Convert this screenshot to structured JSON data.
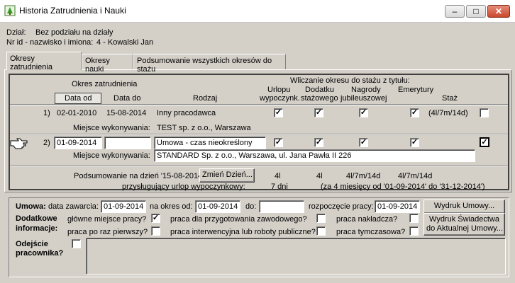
{
  "window": {
    "title": "Historia Zatrudnienia i Nauki",
    "minimize": "–",
    "maximize": "□",
    "close": "✕"
  },
  "info": {
    "dept_label": "Dział:",
    "dept_value": "Bez podziału na działy",
    "id_label": "Nr id - nazwisko i imiona:",
    "id_value": "4 - Kowalski Jan"
  },
  "tabs": [
    {
      "label": "Okresy zatrudnienia",
      "active": true
    },
    {
      "label": "Okresy nauki",
      "active": false
    },
    {
      "label": "Podsumowanie wszystkich okresów do stażu",
      "active": false
    }
  ],
  "table_header": {
    "group_employment": "Okres zatrudnienia",
    "date_from": "Data od",
    "date_to": "Data do",
    "type": "Rodzaj",
    "group_counting": "Wliczanie okresu do stażu z tytułu:",
    "col_leave_1": "Urlopu",
    "col_leave_2": "wypoczynk.",
    "col_bonus_1": "Dodatku",
    "col_bonus_2": "stażowego",
    "col_award_1": "Nagrody",
    "col_award_2": "jubileuszowej",
    "col_pension": "Emerytury",
    "col_seniority": "Staż"
  },
  "rows": [
    {
      "num": "1)",
      "date_from": "02-01-2010",
      "date_to": "15-08-2014",
      "type": "Inny pracodawca",
      "leave": "✓",
      "bonus": "✓",
      "award": "✓",
      "pension": "✓",
      "seniority": "(4l/7m/14d)",
      "seniority_check": "",
      "place_label": "Miejsce wykonywania:",
      "place": "TEST sp. z o.o., Warszawa"
    },
    {
      "num": "2)",
      "date_from": "01-09-2014",
      "date_to": "",
      "type": "Umowa - czas nieokreślony",
      "leave": "✓",
      "bonus": "✓",
      "award": "✓",
      "pension": "✓",
      "seniority": "",
      "seniority_check": "✓",
      "place_label": "Miejsce wykonywania:",
      "place": "STANDARD Sp. z o.o., Warszawa, ul. Jana Pawła II 226"
    }
  ],
  "summary": {
    "label": "Podsumowanie na dzień '15-08-2014'",
    "change_day_button": "Zmień Dzień...",
    "leave": "4l",
    "bonus": "4l",
    "award": "4l/7m/14d",
    "pension": "4l/7m/14d",
    "vacation_label": "przysługujący urlop wypoczynkowy:",
    "vacation_days": "7 dni",
    "vacation_note": "(za 4 miesięcy od '01-09-2014' do '31-12-2014')"
  },
  "contract": {
    "label": "Umowa:",
    "conclusion_label": "data zawarcia:",
    "conclusion_date": "01-09-2014",
    "period_label": "na okres od:",
    "period_from": "01-09-2014",
    "to_label": "do:",
    "period_to": "",
    "start_label": "rozpoczęcie pracy:",
    "start_date": "01-09-2014",
    "print_contract_button": "Wydruk Umowy...",
    "additional_label_1": "Dodatkowe",
    "additional_label_2": "informacje:",
    "main_workplace_label": "główne miejsce pracy?",
    "main_workplace": "✓",
    "vocational_label": "praca dla przygotowania zawodowego?",
    "vocational": "",
    "overseer_label": "praca nakładcza?",
    "overseer": "",
    "first_time_label": "praca po raz pierwszy?",
    "first_time": "",
    "intervention_label": "praca interwencyjna lub roboty publiczne?",
    "intervention": "",
    "temporary_label": "praca tymczasowa?",
    "temporary": "",
    "print_cert_button_1": "Wydruk Świadectwa",
    "print_cert_button_2": "do Aktualnej Umowy...",
    "leaving_label_1": "Odejście",
    "leaving_label_2": "pracownika?",
    "leaving": ""
  },
  "icons": {
    "app": "tree-icon",
    "current_row": "pointing-hand-icon"
  }
}
